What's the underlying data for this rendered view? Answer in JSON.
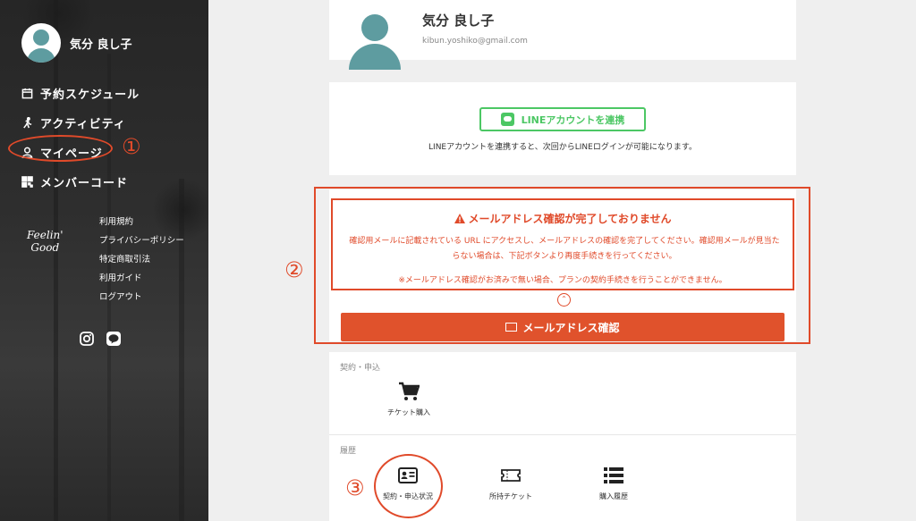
{
  "user": {
    "name": "気分 良し子",
    "email": "kibun.yoshiko@gmail.com"
  },
  "sidebar": {
    "nav": [
      {
        "label": "予約スケジュール",
        "icon": "calendar-icon"
      },
      {
        "label": "アクティビティ",
        "icon": "runner-icon"
      },
      {
        "label": "マイページ",
        "icon": "person-icon"
      },
      {
        "label": "メンバーコード",
        "icon": "qr-code-icon"
      }
    ],
    "logo": {
      "line1": "Feelin'",
      "line2": "Good"
    },
    "links": [
      "利用規約",
      "プライバシーポリシー",
      "特定商取引法",
      "利用ガイド",
      "ログアウト"
    ],
    "social": [
      "instagram-icon",
      "line-icon"
    ]
  },
  "line_link": {
    "button_label": "LINEアカウントを連携",
    "note": "LINEアカウントを連携すると、次回からLINEログインが可能になります。"
  },
  "warning": {
    "title": "メールアドレス確認が完了しておりません",
    "body": "確認用メールに記載されている URL にアクセスし、メールアドレスの確認を完了してください。確認用メールが見当たらない場合は、下記ボタンより再度手続きを行ってください。",
    "note": "※メールアドレス確認がお済みで無い場合、プランの契約手続きを行うことができません。",
    "button_label": "メールアドレス確認"
  },
  "contract": {
    "section_label": "契約・申込",
    "ticket_purchase": "チケット購入"
  },
  "history": {
    "section_label": "履歴",
    "items": [
      "契約・申込状況",
      "所持チケット",
      "購入履歴"
    ]
  },
  "annotations": [
    "①",
    "②",
    "③"
  ],
  "colors": {
    "accent": "#e0522c",
    "line_green": "#4cc764",
    "avatar": "#5e9ca0"
  }
}
